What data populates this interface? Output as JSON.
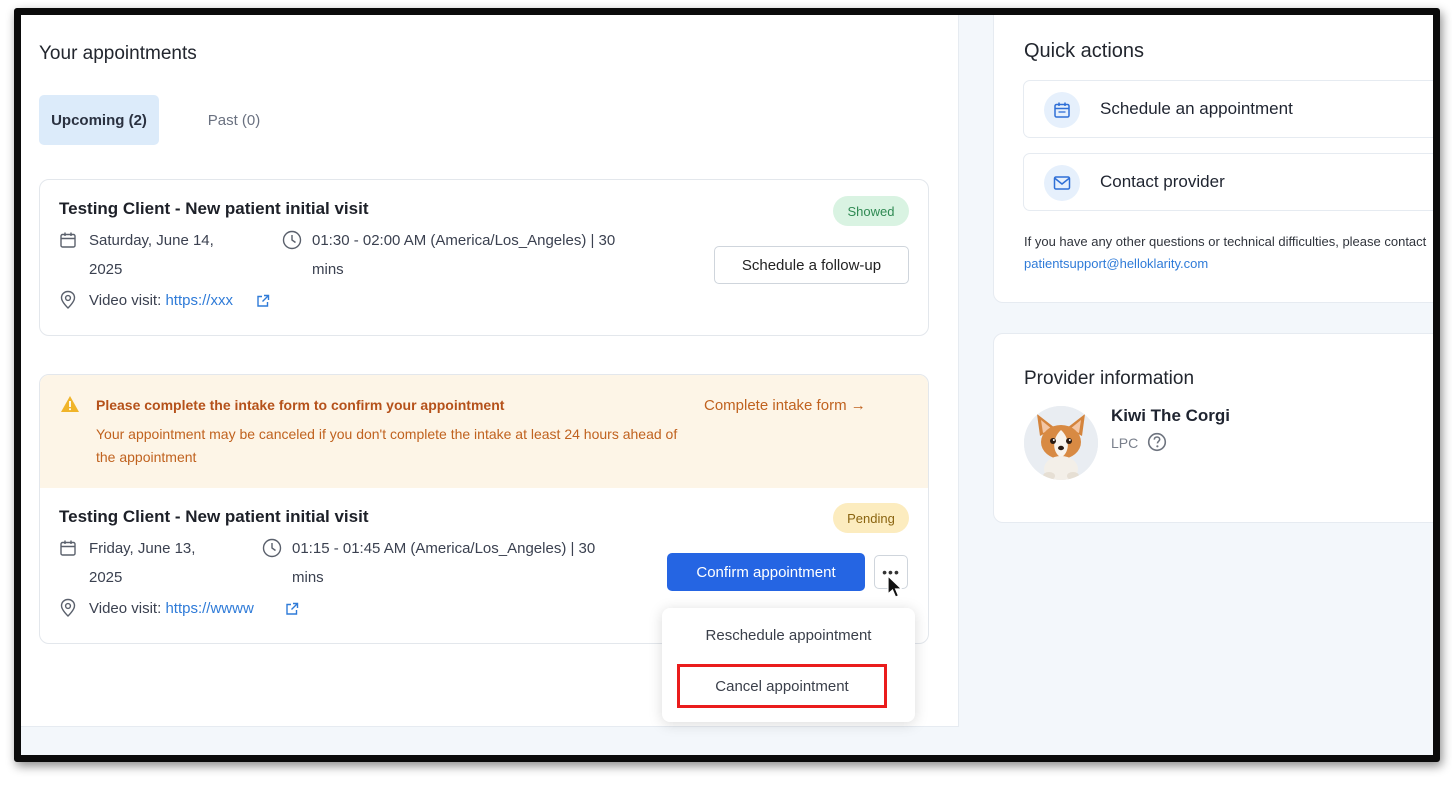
{
  "appointments": {
    "title": "Your appointments",
    "tabs": {
      "upcoming": "Upcoming (2)",
      "past": "Past (0)"
    },
    "items": [
      {
        "title": "Testing Client - New patient initial visit",
        "status": "Showed",
        "date_line1": "Saturday, June 14,",
        "date_line2": "2025",
        "time_line1": "01:30 - 02:00 AM (America/Los_Angeles) | 30",
        "time_line2": "mins",
        "video_label": "Video visit:",
        "video_link": "https://xxx",
        "action": "Schedule a follow-up"
      },
      {
        "title": "Testing Client - New patient initial visit",
        "status": "Pending",
        "date_line1": "Friday, June 13,",
        "date_line2": "2025",
        "time_line1": "01:15 - 01:45 AM (America/Los_Angeles) | 30",
        "time_line2": "mins",
        "video_label": "Video visit:",
        "video_link": "https://wwww",
        "action": "Confirm appointment",
        "more": "•••"
      }
    ],
    "intake_warning": {
      "title": "Please complete the intake form to confirm your appointment",
      "description": "Your appointment may be canceled if you don't complete the intake at least 24 hours ahead of the appointment",
      "link": "Complete intake form →"
    },
    "dropdown": {
      "reschedule": "Reschedule appointment",
      "cancel": "Cancel appointment"
    }
  },
  "quick_actions": {
    "title": "Quick actions",
    "items": [
      "Schedule an appointment",
      "Contact provider"
    ],
    "help_text": "If you have any other questions or technical difficulties, please contact ",
    "help_email": "patientsupport@helloklarity.com"
  },
  "provider": {
    "title": "Provider information",
    "name": "Kiwi The Corgi",
    "credential": "LPC"
  },
  "colors": {
    "primary": "#2565e3",
    "highlight": "#ea1c1c",
    "warning": "#c0621f",
    "link": "#2f7bd8"
  }
}
